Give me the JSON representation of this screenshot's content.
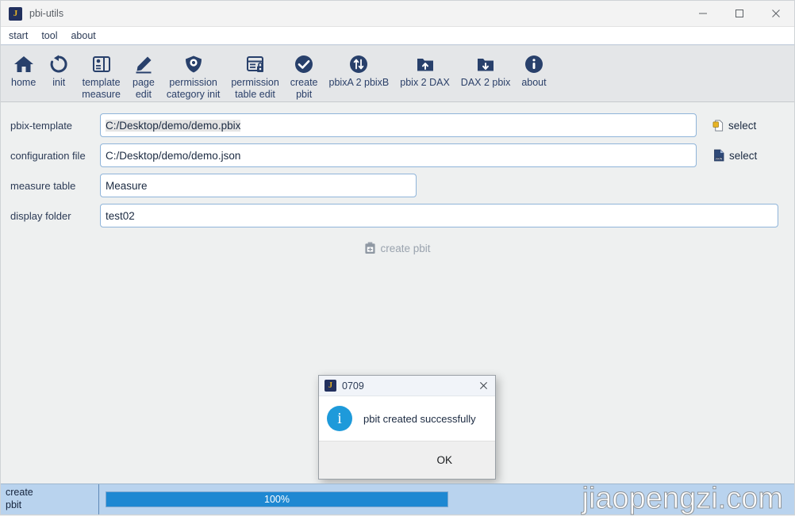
{
  "window": {
    "title": "pbi-utils",
    "app_icon_letter": "J",
    "controls": {
      "minimize": "—",
      "maximize": "☐",
      "close": "✕"
    }
  },
  "menubar": {
    "items": [
      "start",
      "tool",
      "about"
    ]
  },
  "toolbar": {
    "items": [
      {
        "label": "home",
        "icon": "home-icon"
      },
      {
        "label": "init",
        "icon": "refresh-icon"
      },
      {
        "label": "template\nmeasure",
        "icon": "template-measure-icon"
      },
      {
        "label": "page\nedit",
        "icon": "pencil-edit-icon"
      },
      {
        "label": "permission\ncategory init",
        "icon": "shield-gear-icon"
      },
      {
        "label": "permission\ntable edit",
        "icon": "table-lock-icon"
      },
      {
        "label": "create\npbit",
        "icon": "check-circle-icon"
      },
      {
        "label": "pbixA 2 pbixB",
        "icon": "swap-circle-icon"
      },
      {
        "label": "pbix 2 DAX",
        "icon": "folder-up-icon"
      },
      {
        "label": "DAX 2 pbix",
        "icon": "folder-down-icon"
      },
      {
        "label": "about",
        "icon": "info-circle-icon"
      }
    ]
  },
  "form": {
    "fields": [
      {
        "label": "pbix-template",
        "value": "C:/Desktop/demo/demo.pbix",
        "select_label": "select",
        "select_icon": "pbix-file-icon"
      },
      {
        "label": "configuration file",
        "value": "C:/Desktop/demo/demo.json",
        "select_label": "select",
        "select_icon": "json-file-icon"
      },
      {
        "label": "measure table",
        "value": "Measure"
      },
      {
        "label": "display folder",
        "value": "test02"
      }
    ],
    "create_button": {
      "label": "create  pbit",
      "icon": "save-plus-icon",
      "disabled": true
    }
  },
  "dialog": {
    "title": "0709",
    "icon_letter": "J",
    "close_glyph": "✕",
    "info_glyph": "i",
    "message": "pbit created successfully",
    "ok_label": "OK"
  },
  "statusbar": {
    "task_label": "create\npbit",
    "progress_text": "100%",
    "progress_percent": 100,
    "watermark": "jiaopengzi.com"
  },
  "colors": {
    "accent_navy": "#28406b",
    "progress_blue": "#1e88d2",
    "statusbar_blue": "#b9d3ee",
    "info_blue": "#1e9ada",
    "icon_gold": "#e8b425"
  }
}
